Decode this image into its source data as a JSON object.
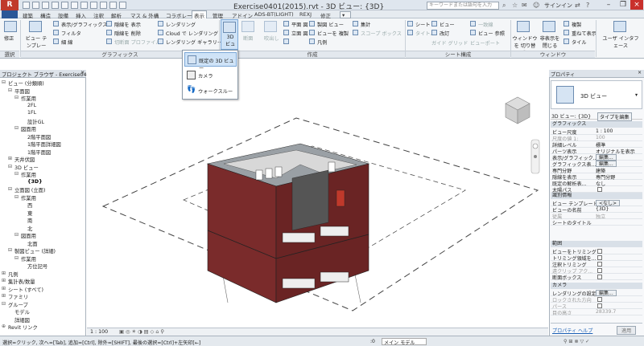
{
  "window": {
    "title": "Exercise0401(2015).rvt - 3D ビュー: {3D}",
    "search_placeholder": "キーワードまたは語句を入力",
    "signin_label": "サインイン",
    "app_button": "R"
  },
  "tabs": [
    "建築",
    "構造",
    "設備",
    "挿入",
    "注釈",
    "解析",
    "マス & 外構",
    "コラボレート",
    "表示",
    "管理",
    "アドイン",
    "ADS-BT(LIGHT)",
    "REXJ",
    "修正"
  ],
  "active_tab": "表示",
  "ribbon": {
    "modify": "修正",
    "view_template": "ビュー テンプレート",
    "vis_graphics": "表示/グラフィックス",
    "filter": "フィルタ",
    "thin_lines": "細 線",
    "show_hidden": "隠線を 表示",
    "remove_hidden": "隠線を 削除",
    "cut_profile": "切断面 プロファイル",
    "rendering": "レンダリング",
    "cloud_rendering": "Cloud で レンダリング",
    "rendering_gallery": "レンダリング ギャラリー",
    "view_3d": "3D ビュー",
    "section": "断面",
    "callout": "吹出し",
    "plan_view": "平面 図",
    "elevation": "立面 図",
    "drafting_view": "製図 ビュー",
    "duplicate_view": "ビューを 複製",
    "legend": "凡例",
    "schedule": "集計",
    "scope_box": "スコープ ボックス",
    "sheet": "シート",
    "title_block": "タイトル",
    "view": "ビュー",
    "revision": "改訂",
    "guide_grid": "ガイド グリッド",
    "match_line": "一致線",
    "view_reference": "ビュー 参照",
    "viewports": "ビューポート",
    "switch_windows": "ウィンドウを 切り替え",
    "close_hidden": "非表示を 閉じる",
    "replicate": "複製",
    "cascade": "重ねて表示",
    "tile": "タイル",
    "user_interface": "ユーザ インタフェース",
    "group_select": "選択",
    "group_graphics": "グラフィックス",
    "group_create": "作成",
    "group_sheet": "シート構成",
    "group_window": "ウィンドウ"
  },
  "dropdown": {
    "items": [
      "既定の 3D ビュー",
      "カメラ",
      "ウォークスルー"
    ]
  },
  "browser": {
    "title": "プロジェクト ブラウザ - Exercise0401(2...",
    "items": [
      {
        "label": "ビュー (分類順)",
        "indent": 0,
        "exp": "⊟"
      },
      {
        "label": "平面図",
        "indent": 1,
        "exp": "⊟"
      },
      {
        "label": "作業用",
        "indent": 2,
        "exp": "⊟"
      },
      {
        "label": "2FL",
        "indent": 3,
        "exp": ""
      },
      {
        "label": "1FL",
        "indent": 3,
        "exp": ""
      },
      {
        "label": "設計GL",
        "indent": 3,
        "exp": ""
      },
      {
        "label": "図面用",
        "indent": 2,
        "exp": "⊟"
      },
      {
        "label": "2階平面図",
        "indent": 3,
        "exp": ""
      },
      {
        "label": "1階平面詳細図",
        "indent": 3,
        "exp": ""
      },
      {
        "label": "1階平面図",
        "indent": 3,
        "exp": ""
      },
      {
        "label": "天井伏図",
        "indent": 1,
        "exp": "⊞"
      },
      {
        "label": "3D ビュー",
        "indent": 1,
        "exp": "⊟"
      },
      {
        "label": "作業用",
        "indent": 2,
        "exp": "⊟"
      },
      {
        "label": "{3D}",
        "indent": 3,
        "exp": "",
        "selected": true
      },
      {
        "label": "立面図 (立面)",
        "indent": 1,
        "exp": "⊟"
      },
      {
        "label": "作業用",
        "indent": 2,
        "exp": "⊟"
      },
      {
        "label": "西",
        "indent": 3,
        "exp": ""
      },
      {
        "label": "東",
        "indent": 3,
        "exp": ""
      },
      {
        "label": "南",
        "indent": 3,
        "exp": ""
      },
      {
        "label": "北",
        "indent": 3,
        "exp": ""
      },
      {
        "label": "図面用",
        "indent": 2,
        "exp": "⊟"
      },
      {
        "label": "北面",
        "indent": 3,
        "exp": ""
      },
      {
        "label": "製図ビュー (詳細)",
        "indent": 1,
        "exp": "⊟"
      },
      {
        "label": "作業用",
        "indent": 2,
        "exp": "⊟"
      },
      {
        "label": "方位記号",
        "indent": 3,
        "exp": ""
      },
      {
        "label": "凡例",
        "indent": 0,
        "exp": "⊞"
      },
      {
        "label": "集計表/数量",
        "indent": 0,
        "exp": "⊞"
      },
      {
        "label": "シート (すべて)",
        "indent": 0,
        "exp": "⊞"
      },
      {
        "label": "ファミリ",
        "indent": 0,
        "exp": "⊞"
      },
      {
        "label": "グループ",
        "indent": 0,
        "exp": "⊟"
      },
      {
        "label": "モデル",
        "indent": 1,
        "exp": ""
      },
      {
        "label": "詳細図",
        "indent": 1,
        "exp": ""
      },
      {
        "label": "Revit リンク",
        "indent": 0,
        "exp": "⊕"
      }
    ]
  },
  "viewbar": {
    "scale": "1 : 100"
  },
  "properties": {
    "title": "プロパティ",
    "type_name": "3D ビュー",
    "instance": "3D ビュー: {3D}",
    "edit_type": "タイプを編集",
    "sections": {
      "graphics": "グラフィックス",
      "identity": "識別情報",
      "extents": "範囲",
      "camera": "カメラ"
    },
    "rows": [
      {
        "label": "ビュー尺度",
        "value": "1 : 100",
        "dim": false
      },
      {
        "label": "尺度の値  1:",
        "value": "100",
        "dim": true
      },
      {
        "label": "詳細レベル",
        "value": "標準",
        "dim": false
      },
      {
        "label": "パーツ表示",
        "value": "オリジナルを表示",
        "dim": false
      },
      {
        "label": "表示/グラフィック...",
        "value": "編集...",
        "dim": false,
        "button": true
      },
      {
        "label": "グラフィックス表...",
        "value": "編集...",
        "dim": false,
        "button": true
      },
      {
        "label": "専門分野",
        "value": "建築",
        "dim": false
      },
      {
        "label": "隠線を表示",
        "value": "専門分野",
        "dim": false
      },
      {
        "label": "既定の解析表...",
        "value": "なし",
        "dim": false
      },
      {
        "label": "太陽パス",
        "value": "",
        "dim": false,
        "check": true
      }
    ],
    "identity_rows": [
      {
        "label": "ビュー テンプレート",
        "value": "<なし>",
        "button": true
      },
      {
        "label": "ビューの名前",
        "value": "{3D}"
      },
      {
        "label": "従属",
        "value": "独立",
        "dim": true
      },
      {
        "label": "シートのタイトル",
        "value": ""
      }
    ],
    "extent_rows": [
      {
        "label": "ビューをトリミング",
        "check": true
      },
      {
        "label": "トリミング領域を...",
        "check": true
      },
      {
        "label": "注釈トリミング",
        "check": true
      },
      {
        "label": "遠クリップ アク...",
        "check": true,
        "dim": true
      },
      {
        "label": "断面ボックス",
        "check": true
      }
    ],
    "camera_rows": [
      {
        "label": "レンダリングの設定",
        "value": "編集...",
        "button": true
      },
      {
        "label": "ロックされた方向",
        "check": true,
        "dim": true
      },
      {
        "label": "パース",
        "check": true,
        "dim": true
      },
      {
        "label": "目の高さ",
        "value": "28339.7",
        "dim": true
      }
    ],
    "help_link": "プロパティ ヘルプ",
    "apply": "適用"
  },
  "status": {
    "text": "選択=クリック, 次へ=[Tab], 追加=[Ctrl], 除外=[SHIFT], 最後の選択=[Ctrl]+左矢印[←]",
    "zero": ":0",
    "main_model": "メイン モデル"
  }
}
